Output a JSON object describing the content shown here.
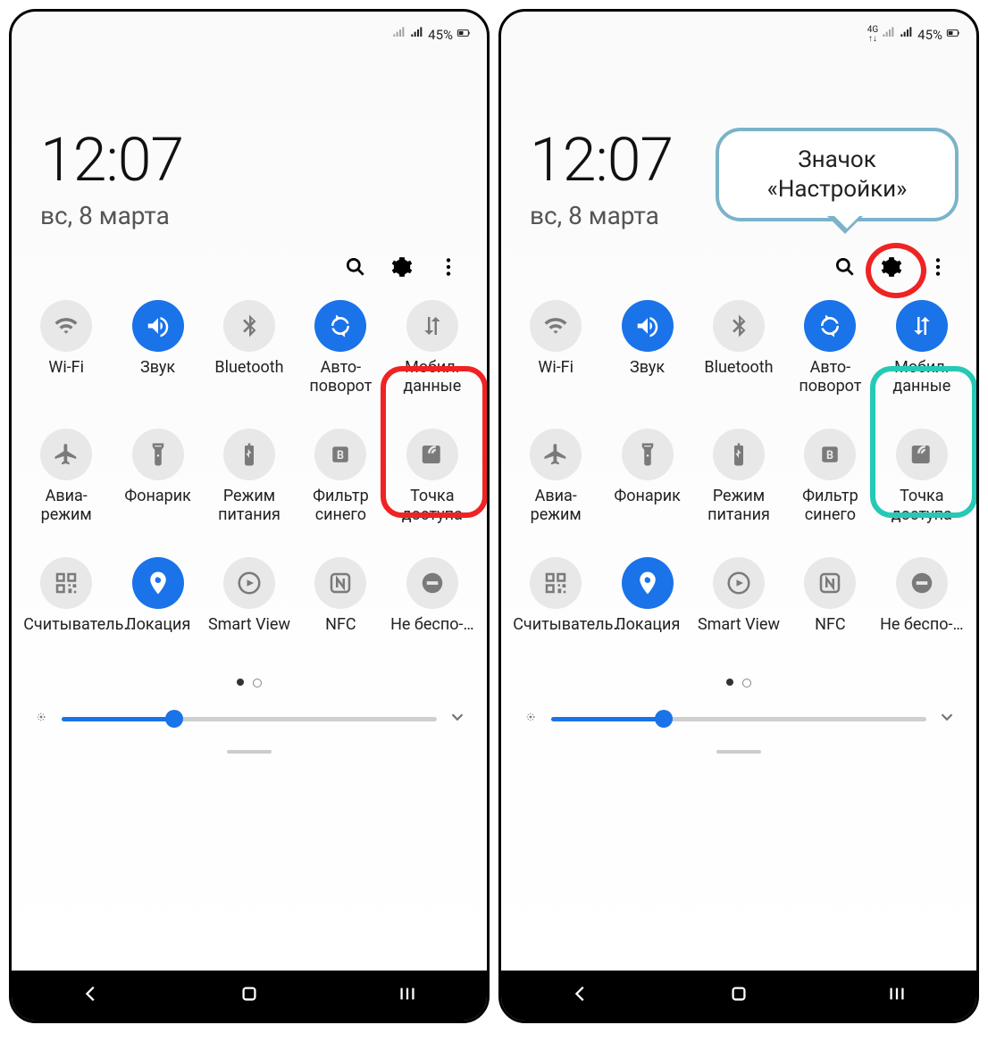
{
  "screens": [
    {
      "status": {
        "network4g": false,
        "battery_text": "45%"
      },
      "time": "12:07",
      "date": "вс, 8 марта",
      "tiles": [
        {
          "label": "Wi-Fi",
          "on": false,
          "icon": "wifi"
        },
        {
          "label": "Звук",
          "on": true,
          "icon": "sound"
        },
        {
          "label": "Bluetooth",
          "on": false,
          "icon": "bluetooth"
        },
        {
          "label": "Авто-поворот",
          "on": true,
          "icon": "rotate"
        },
        {
          "label": "Мобил. данные",
          "on": false,
          "icon": "data"
        },
        {
          "label": "Авиа-режим",
          "on": false,
          "icon": "airplane"
        },
        {
          "label": "Фонарик",
          "on": false,
          "icon": "flashlight"
        },
        {
          "label": "Режим питания",
          "on": false,
          "icon": "battery"
        },
        {
          "label": "Фильтр синего",
          "on": false,
          "icon": "bluefilter"
        },
        {
          "label": "Точка доступа",
          "on": false,
          "icon": "hotspot"
        },
        {
          "label": "Считыватель…",
          "on": false,
          "icon": "qr"
        },
        {
          "label": "Локация",
          "on": true,
          "icon": "location"
        },
        {
          "label": "Smart View",
          "on": false,
          "icon": "smartview"
        },
        {
          "label": "NFC",
          "on": false,
          "icon": "nfc"
        },
        {
          "label": "Не беспо-…",
          "on": false,
          "icon": "dnd"
        }
      ],
      "brightness_pct": 30,
      "highlight": {
        "type": "red-rect",
        "target": "tile-4"
      }
    },
    {
      "status": {
        "network4g": true,
        "battery_text": "45%"
      },
      "time": "12:07",
      "date": "вс, 8 марта",
      "tiles": [
        {
          "label": "Wi-Fi",
          "on": false,
          "icon": "wifi"
        },
        {
          "label": "Звук",
          "on": true,
          "icon": "sound"
        },
        {
          "label": "Bluetooth",
          "on": false,
          "icon": "bluetooth"
        },
        {
          "label": "Авто-поворот",
          "on": true,
          "icon": "rotate"
        },
        {
          "label": "Мобил. данные",
          "on": true,
          "icon": "data"
        },
        {
          "label": "Авиа-режим",
          "on": false,
          "icon": "airplane"
        },
        {
          "label": "Фонарик",
          "on": false,
          "icon": "flashlight"
        },
        {
          "label": "Режим питания",
          "on": false,
          "icon": "battery"
        },
        {
          "label": "Фильтр синего",
          "on": false,
          "icon": "bluefilter"
        },
        {
          "label": "Точка доступа",
          "on": false,
          "icon": "hotspot"
        },
        {
          "label": "Считыватель…",
          "on": false,
          "icon": "qr"
        },
        {
          "label": "Локация",
          "on": true,
          "icon": "location"
        },
        {
          "label": "Smart View",
          "on": false,
          "icon": "smartview"
        },
        {
          "label": "NFC",
          "on": false,
          "icon": "nfc"
        },
        {
          "label": "Не беспо-…",
          "on": false,
          "icon": "dnd"
        }
      ],
      "brightness_pct": 30,
      "highlight": {
        "type": "teal-rect",
        "target": "tile-4"
      },
      "gear_highlight": true,
      "callout_text": "Значок «Настройки»"
    }
  ],
  "colors": {
    "accent": "#1a73e8",
    "red": "#ef2323",
    "teal": "#26c9b5",
    "callout_border": "#7bb3c9"
  }
}
